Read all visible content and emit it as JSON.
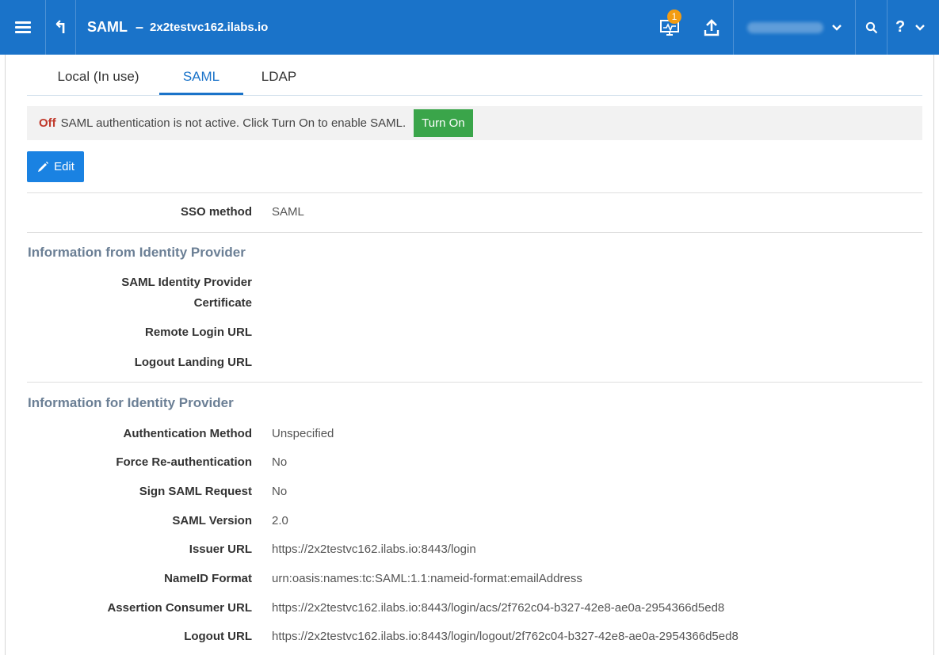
{
  "topbar": {
    "app_title": "SAML",
    "separator": "–",
    "hostname": "2x2testvc162.ilabs.io",
    "notification_count": "1"
  },
  "tabs": [
    {
      "label": "Local (In use)",
      "active": false
    },
    {
      "label": "SAML",
      "active": true
    },
    {
      "label": "LDAP",
      "active": false
    }
  ],
  "status": {
    "state": "Off",
    "message": "SAML authentication is not active. Click Turn On to enable SAML.",
    "turn_on_label": "Turn On"
  },
  "edit_label": "Edit",
  "sso": {
    "label": "SSO method",
    "value": "SAML"
  },
  "from_idp": {
    "heading": "Information from Identity Provider",
    "cert_label_line1": "SAML Identity Provider",
    "cert_label_line2": "Certificate",
    "remote_login_label": "Remote Login URL",
    "logout_landing_label": "Logout Landing URL"
  },
  "for_idp": {
    "heading": "Information for Identity Provider",
    "rows": [
      {
        "label": "Authentication Method",
        "value": "Unspecified"
      },
      {
        "label": "Force Re-authentication",
        "value": "No"
      },
      {
        "label": "Sign SAML Request",
        "value": "No"
      },
      {
        "label": "SAML Version",
        "value": "2.0"
      },
      {
        "label": "Issuer URL",
        "value": "https://2x2testvc162.ilabs.io:8443/login"
      },
      {
        "label": "NameID Format",
        "value": "urn:oasis:names:tc:SAML:1.1:nameid-format:emailAddress"
      },
      {
        "label": "Assertion Consumer URL",
        "value": "https://2x2testvc162.ilabs.io:8443/login/acs/2f762c04-b327-42e8-ae0a-2954366d5ed8"
      },
      {
        "label": "Logout URL",
        "value": "https://2x2testvc162.ilabs.io:8443/login/logout/2f762c04-b327-42e8-ae0a-2954366d5ed8"
      }
    ]
  },
  "colors": {
    "topbar": "#1a73c9",
    "primary": "#1a82e2",
    "success": "#3aa54a",
    "off": "#c0392b",
    "section_heading": "#6b7f95"
  }
}
